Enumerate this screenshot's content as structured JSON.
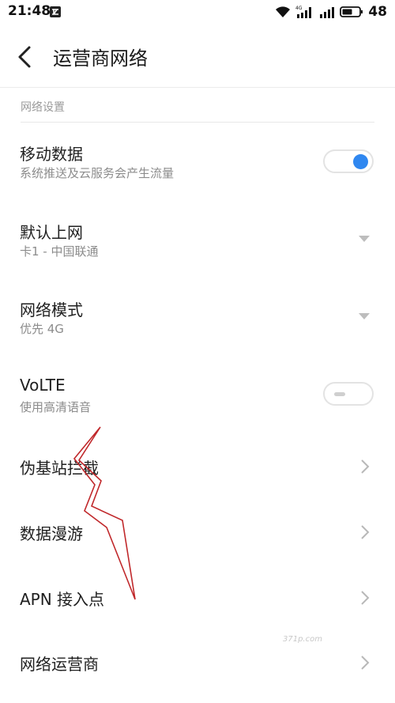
{
  "status_bar": {
    "time": "21:48",
    "network_type": "4G",
    "battery": "48"
  },
  "header": {
    "title": "运营商网络"
  },
  "section": {
    "label": "网络设置"
  },
  "settings": {
    "mobile_data": {
      "title": "移动数据",
      "subtitle": "系统推送及云服务会产生流量",
      "enabled": true
    },
    "default_network": {
      "title": "默认上网",
      "value": "卡1 - 中国联通"
    },
    "network_mode": {
      "title": "网络模式",
      "value": "优先 4G"
    },
    "volte": {
      "title": "VoLTE",
      "subtitle": "使用高清语音",
      "enabled": false
    },
    "fake_base_station_block": {
      "title": "伪基站拦截"
    },
    "data_roaming": {
      "title": "数据漫游"
    },
    "apn": {
      "title": "APN 接入点"
    },
    "carrier": {
      "title": "网络运营商"
    }
  },
  "colors": {
    "accent": "#2f87f0",
    "annotation": "#c0282b"
  },
  "watermark": "371p.com"
}
